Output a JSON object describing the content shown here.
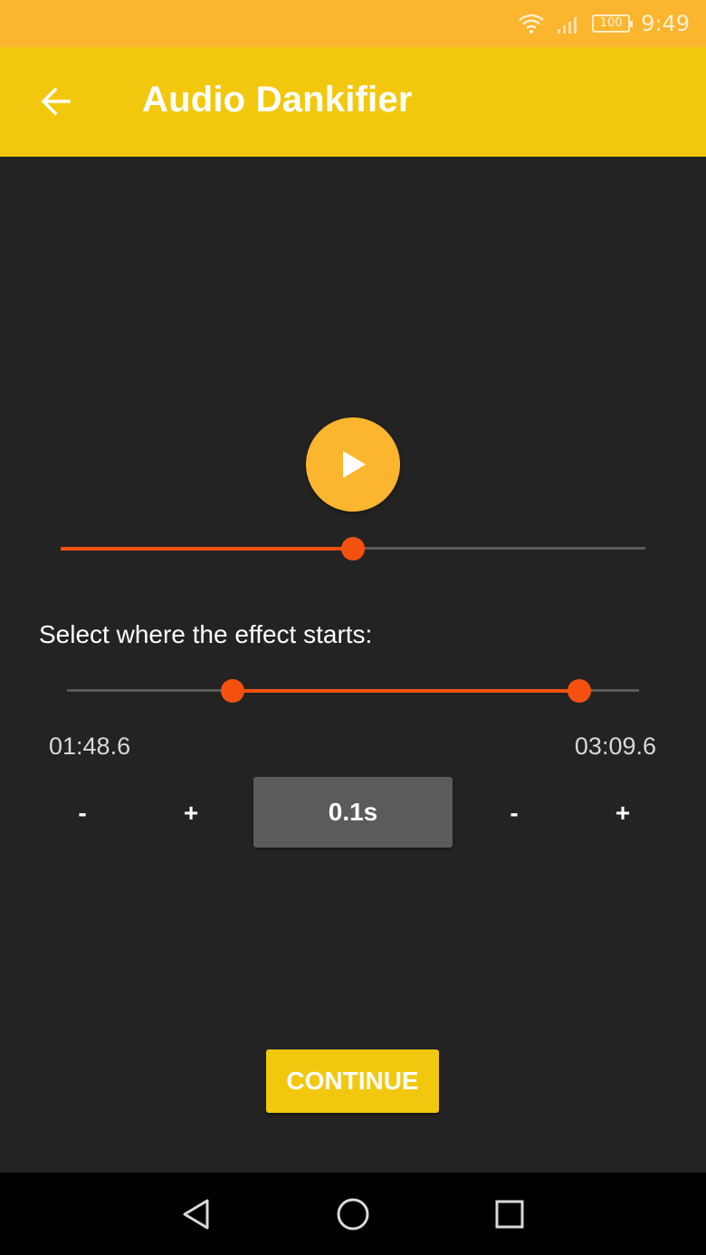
{
  "status_bar": {
    "time": "9:49",
    "battery": "100",
    "icons": [
      "wifi-icon",
      "signal-icon",
      "battery-icon"
    ]
  },
  "app_bar": {
    "title": "Audio Dankifier",
    "back_icon": "arrow-left-icon"
  },
  "player": {
    "play_icon": "play-icon",
    "progress": 0.5
  },
  "effect_range": {
    "label": "Select where the effect starts:",
    "start_fraction": 0.29,
    "end_fraction": 0.895,
    "start_time": "01:48.6",
    "end_time": "03:09.6"
  },
  "steppers": {
    "start_minus": "-",
    "start_plus": "+",
    "step_size": "0.1s",
    "end_minus": "-",
    "end_plus": "+"
  },
  "actions": {
    "continue_label": "CONTINUE"
  },
  "nav_bar": {
    "icons": [
      "nav-back-icon",
      "nav-home-icon",
      "nav-recents-icon"
    ]
  },
  "colors": {
    "status_bar": "#fbb52e",
    "app_bar": "#f2c80f",
    "background": "#232323",
    "accent": "#f4510f",
    "play_button": "#fbb52e",
    "step_button": "#5b5b5b"
  }
}
